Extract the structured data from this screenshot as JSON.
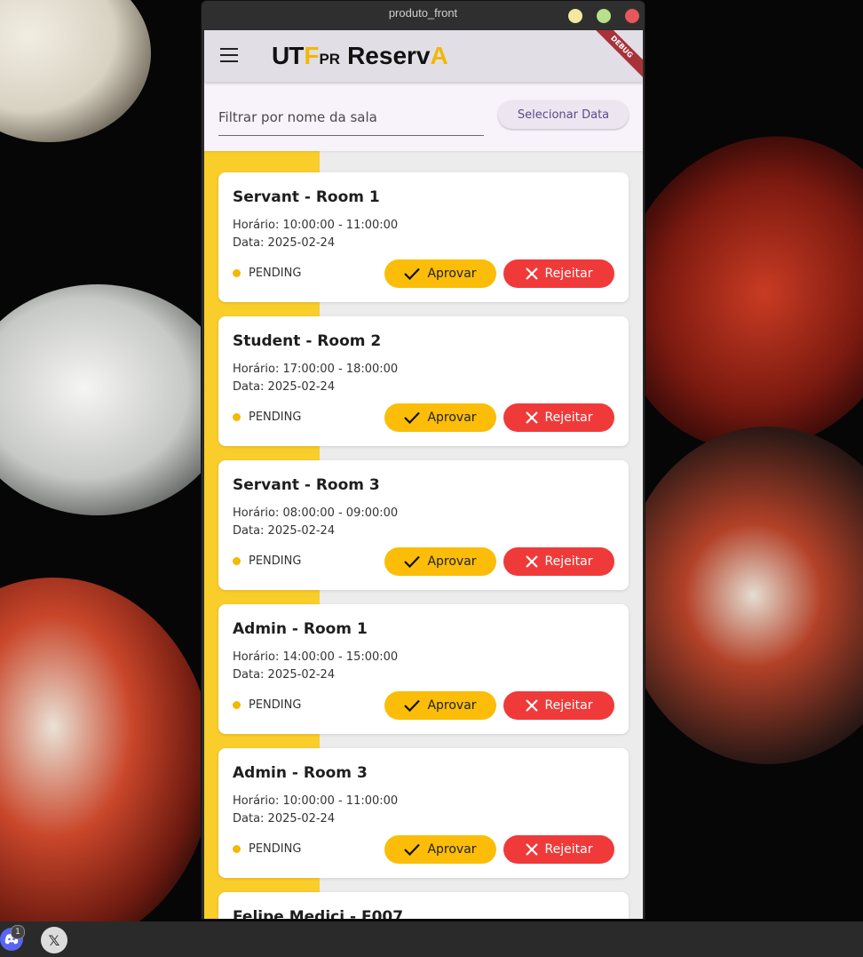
{
  "window": {
    "title": "produto_front"
  },
  "appbar": {
    "logo_part1": "U",
    "logo_part2": "T",
    "logo_part2b": "F",
    "logo_part3": "PR",
    "logo_part4": "Reserv",
    "logo_part5": "A",
    "debug_label": "DEBUG"
  },
  "filter": {
    "placeholder": "Filtrar por nome da sala",
    "date_button": "Selecionar Data"
  },
  "buttons": {
    "approve": "Aprovar",
    "reject": "Rejeitar"
  },
  "reservations": [
    {
      "title": "Servant - Room 1",
      "time": "Horário: 10:00:00 - 11:00:00",
      "date": "Data: 2025-02-24",
      "status": "PENDING"
    },
    {
      "title": "Student - Room 2",
      "time": "Horário: 17:00:00 - 18:00:00",
      "date": "Data: 2025-02-24",
      "status": "PENDING"
    },
    {
      "title": "Servant - Room 3",
      "time": "Horário: 08:00:00 - 09:00:00",
      "date": "Data: 2025-02-24",
      "status": "PENDING"
    },
    {
      "title": "Admin - Room 1",
      "time": "Horário: 14:00:00 - 15:00:00",
      "date": "Data: 2025-02-24",
      "status": "PENDING"
    },
    {
      "title": "Admin - Room 3",
      "time": "Horário: 10:00:00 - 11:00:00",
      "date": "Data: 2025-02-24",
      "status": "PENDING"
    }
  ],
  "partial_card_title": "Felipe Medici - E007",
  "taskbar": {
    "badge_count": "1"
  },
  "colors": {
    "approve": "#fbbd08",
    "reject": "#f03a3a",
    "status_pending": "#f5b800",
    "accent_yellow": "#f7c51f"
  }
}
